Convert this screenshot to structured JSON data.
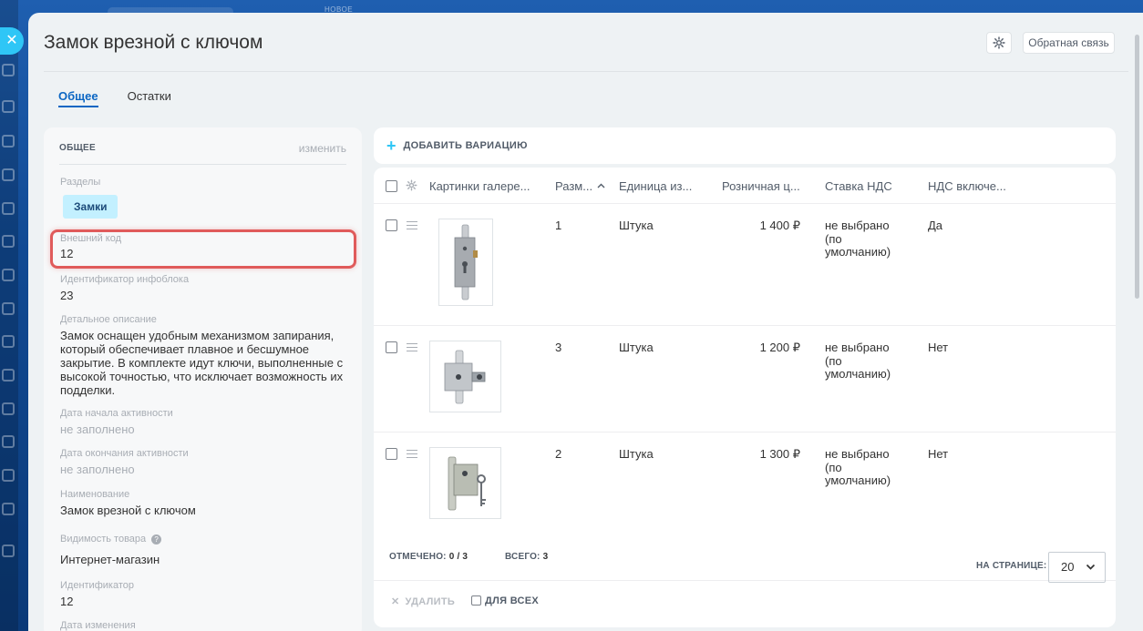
{
  "background": {
    "top_label": "НОВОЕ"
  },
  "header": {
    "title": "Замок врезной с ключом",
    "feedback_label": "Обратная связь"
  },
  "tabs": [
    {
      "label": "Общее",
      "active": true
    },
    {
      "label": "Остатки",
      "active": false
    }
  ],
  "info": {
    "heading": "ОБЩЕЕ",
    "edit_label": "изменить",
    "sections_label": "Разделы",
    "section_chip": "Замки",
    "external_code_label": "Внешний код",
    "external_code_value": "12",
    "iblock_id_label": "Идентификатор инфоблока",
    "iblock_id_value": "23",
    "description_label": "Детальное описание",
    "description_value": "Замок оснащен удобным механизмом запирания, который обеспечивает плавное и бесшумное закрытие. В комплекте идут ключи, выполненные с высокой точностью, что исключает возможность их подделки.",
    "active_from_label": "Дата начала активности",
    "active_from_value": "не заполнено",
    "active_to_label": "Дата окончания активности",
    "active_to_value": "не заполнено",
    "name_label": "Наименование",
    "name_value": "Замок врезной с ключом",
    "visibility_label": "Видимость товара",
    "visibility_value": "Интернет-магазин",
    "id_label": "Идентификатор",
    "id_value": "12",
    "modified_label": "Дата изменения"
  },
  "variations": {
    "add_label": "ДОБАВИТЬ ВАРИАЦИЮ",
    "columns": {
      "gallery": "Картинки галере...",
      "size": "Разм...",
      "unit": "Единица из...",
      "price": "Розничная ц...",
      "vat_rate": "Ставка НДС",
      "vat_included": "НДС включе..."
    },
    "rows": [
      {
        "size": "1",
        "unit": "Штука",
        "price": "1 400 ₽",
        "vat_rate": "не выбрано (по умолчанию)",
        "vat_included": "Да"
      },
      {
        "size": "3",
        "unit": "Штука",
        "price": "1 200 ₽",
        "vat_rate": "не выбрано (по умолчанию)",
        "vat_included": "Нет"
      },
      {
        "size": "2",
        "unit": "Штука",
        "price": "1 300 ₽",
        "vat_rate": "не выбрано (по умолчанию)",
        "vat_included": "Нет"
      }
    ],
    "selected_label": "ОТМЕЧЕНО:",
    "selected_value": "0 / 3",
    "total_label": "ВСЕГО:",
    "total_value": "3",
    "per_page_label": "НА СТРАНИЦЕ:",
    "per_page_value": "20",
    "delete_label": "УДАЛИТЬ",
    "for_all_label": "ДЛЯ ВСЕХ"
  }
}
